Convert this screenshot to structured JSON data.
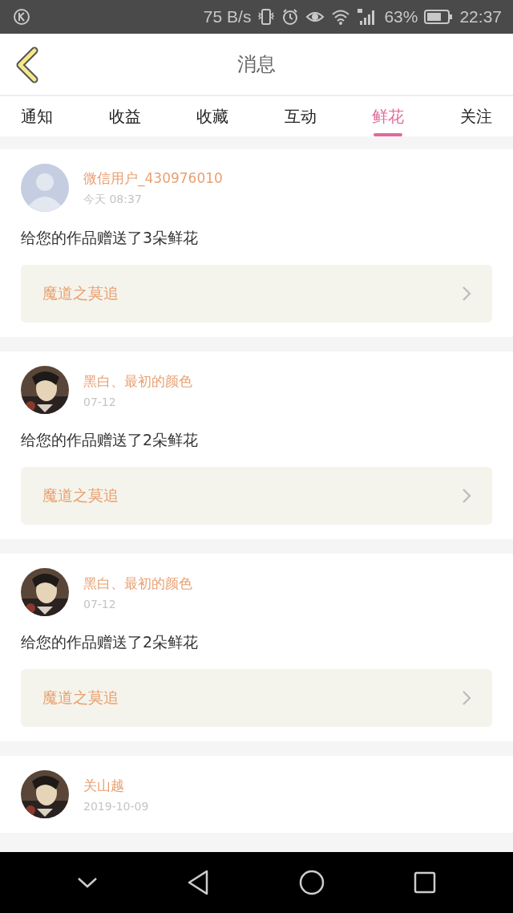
{
  "status_bar": {
    "speed": "75 B/s",
    "battery": "63%",
    "time": "22:37"
  },
  "header": {
    "title": "消息"
  },
  "tabs": [
    {
      "label": "通知",
      "selected": false
    },
    {
      "label": "收益",
      "selected": false
    },
    {
      "label": "收藏",
      "selected": false
    },
    {
      "label": "互动",
      "selected": false
    },
    {
      "label": "鲜花",
      "selected": true
    },
    {
      "label": "关注",
      "selected": false
    }
  ],
  "messages": [
    {
      "avatar": {
        "kind": "default"
      },
      "user": "微信用户_430976010",
      "time": "今天 08:37",
      "text": "给您的作品赠送了3朵鲜花",
      "work": "魔道之莫追"
    },
    {
      "user": "黑白、最初的颜色",
      "time": "07-12",
      "text": "给您的作品赠送了2朵鲜花",
      "work": "魔道之莫追"
    },
    {
      "user": "黑白、最初的颜色",
      "time": "07-12",
      "text": "给您的作品赠送了2朵鲜花",
      "work": "魔道之莫追"
    },
    {
      "user": "关山越",
      "time": "2019-10-09"
    }
  ]
}
